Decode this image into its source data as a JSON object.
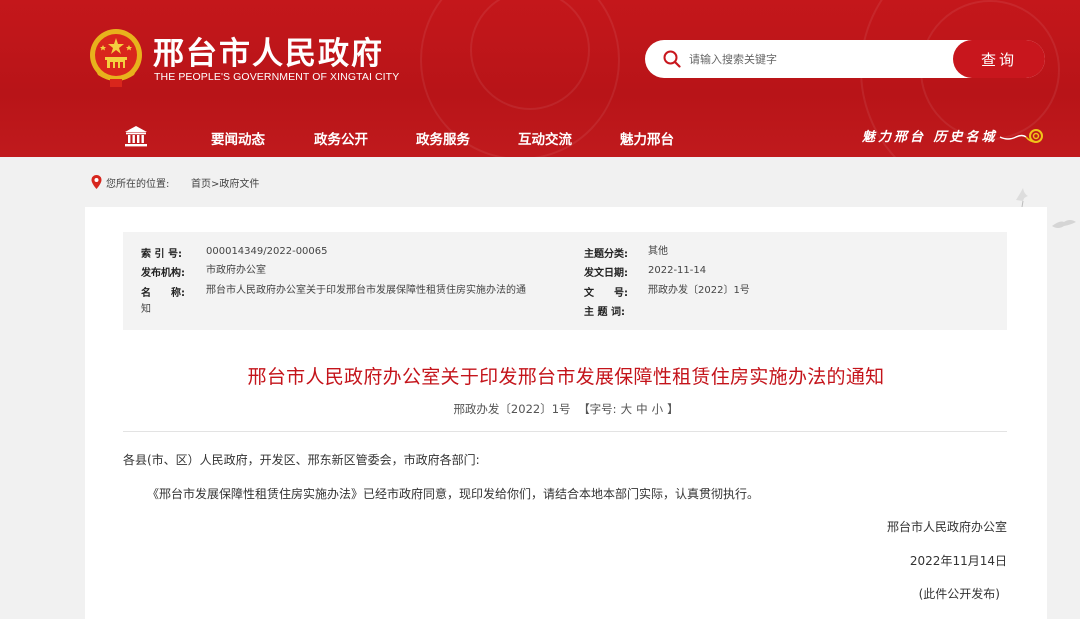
{
  "header": {
    "title": "邢台市人民政府",
    "subtitle": "THE PEOPLE'S GOVERNMENT OF XINGTAI CITY",
    "search_placeholder": "请输入搜索关键字",
    "search_button": "查询",
    "nav": [
      "要闻动态",
      "政务公开",
      "政务服务",
      "互动交流",
      "魅力邢台"
    ],
    "slogan": "魅力邢台 历史名城",
    "brand_color": "#c4171b"
  },
  "breadcrumb": {
    "label": "您所在的位置:",
    "path": "首页>政府文件"
  },
  "meta": {
    "index_key": "索 引 号:",
    "index_value": "000014349/2022-00065",
    "org_key": "发布机构:",
    "org_value": "市政府办公室",
    "name_key": "名　　称:",
    "name_value_line1": "邢台市人民政府办公室关于印发邢台市发展保障性租赁住房实施办法的通",
    "name_value_line2": "知",
    "category_key": "主题分类:",
    "category_value": "其他",
    "date_key": "发文日期:",
    "date_value": "2022-11-14",
    "docno_key": "文　　号:",
    "docno_value": "邢政办发〔2022〕1号",
    "keywords_key": "主 题 词:",
    "keywords_value": ""
  },
  "document": {
    "title": "邢台市人民政府办公室关于印发邢台市发展保障性租赁住房实施办法的通知",
    "doc_number": "邢政办发〔2022〕1号",
    "font_size_label": "【字号:",
    "size_large": "大",
    "size_medium": "中",
    "size_small": "小",
    "font_size_close": "】",
    "recipients": "各县(市、区）人民政府，开发区、邢东新区管委会，市政府各部门:",
    "body": "《邢台市发展保障性租赁住房实施办法》已经市政府同意，现印发给你们，请结合本地本部门实际，认真贯彻执行。",
    "signer": "邢台市人民政府办公室",
    "date": "2022年11月14日",
    "note": "(此件公开发布)"
  }
}
